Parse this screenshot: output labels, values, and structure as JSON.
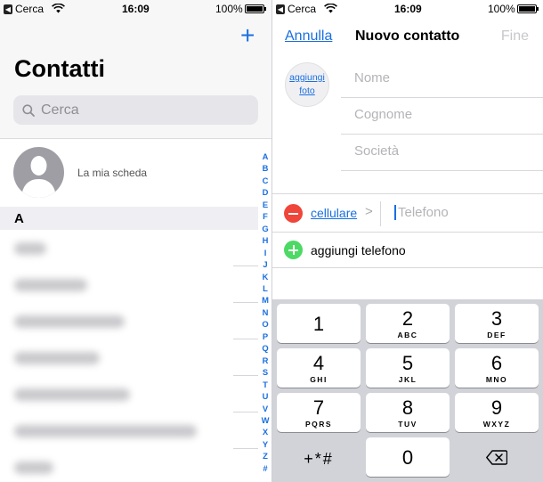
{
  "left": {
    "status_bar": {
      "back_app": "Cerca",
      "time": "16:09",
      "battery": "100%"
    },
    "add_symbol": "+",
    "title": "Contatti",
    "search_placeholder": "Cerca",
    "my_card_label": "La mia scheda",
    "section_letter": "A",
    "index_letters": [
      "A",
      "B",
      "C",
      "D",
      "E",
      "F",
      "G",
      "H",
      "I",
      "J",
      "K",
      "L",
      "M",
      "N",
      "O",
      "P",
      "Q",
      "R",
      "S",
      "T",
      "U",
      "V",
      "W",
      "X",
      "Y",
      "Z",
      "#"
    ]
  },
  "right": {
    "status_bar": {
      "back_app": "Cerca",
      "time": "16:09",
      "battery": "100%"
    },
    "nav": {
      "cancel": "Annulla",
      "title": "Nuovo contatto",
      "done": "Fine"
    },
    "photo": {
      "line1": "aggiungi",
      "line2": "foto"
    },
    "fields": {
      "first_name_placeholder": "Nome",
      "last_name_placeholder": "Cognome",
      "company_placeholder": "Società"
    },
    "phone": {
      "label": "cellulare",
      "chevron": ">",
      "placeholder": "Telefono"
    },
    "add_phone": "aggiungi telefono",
    "keypad": [
      {
        "num": "1",
        "letters": ""
      },
      {
        "num": "2",
        "letters": "ABC"
      },
      {
        "num": "3",
        "letters": "DEF"
      },
      {
        "num": "4",
        "letters": "GHI"
      },
      {
        "num": "5",
        "letters": "JKL"
      },
      {
        "num": "6",
        "letters": "MNO"
      },
      {
        "num": "7",
        "letters": "PQRS"
      },
      {
        "num": "8",
        "letters": "TUV"
      },
      {
        "num": "9",
        "letters": "WXYZ"
      },
      {
        "num": "+*#",
        "letters": ""
      },
      {
        "num": "0",
        "letters": ""
      }
    ]
  },
  "colors": {
    "accent": "#1a6fe0",
    "remove": "#f0453a",
    "add": "#4cd964",
    "keypad_bg": "#d1d3d9"
  },
  "icons": [
    "back-arrow-icon",
    "wifi-icon",
    "battery-icon",
    "plus-icon",
    "search-icon",
    "person-silhouette-icon",
    "chevron-right-icon",
    "minus-circle-icon",
    "plus-circle-icon",
    "backspace-icon"
  ]
}
